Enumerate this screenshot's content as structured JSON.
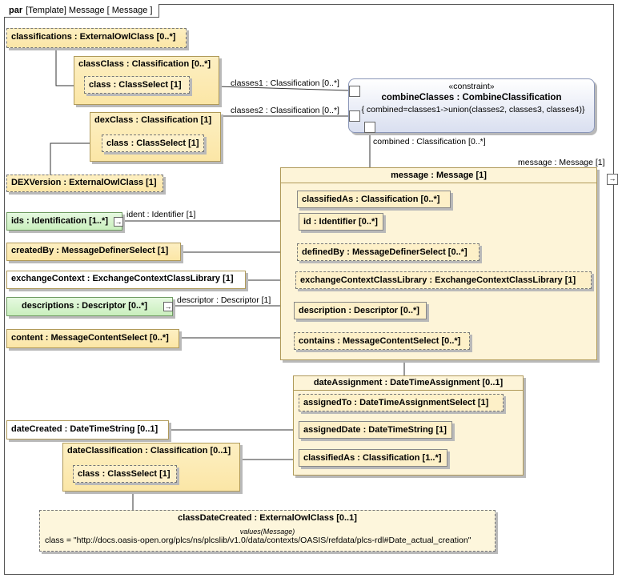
{
  "frame": {
    "keyword": "par",
    "title": "[Template] Message [ Message ]"
  },
  "blocks": {
    "classifications": "classifications : ExternalOwlClass [0..*]",
    "classClass": "classClass : Classification [0..*]",
    "classClass_part": "class : ClassSelect [1]",
    "dexClass": "dexClass : Classification [1]",
    "dexClass_part": "class : ClassSelect [1]",
    "dexVersion": "DEXVersion : ExternalOwlClass [1]",
    "ids": "ids : Identification [1..*]",
    "createdBy": "createdBy : MessageDefinerSelect [1]",
    "exchangeContext": "exchangeContext : ExchangeContextClassLibrary [1]",
    "descriptions": "descriptions : Descriptor [0..*]",
    "content": "content : MessageContentSelect [0..*]",
    "dateCreated": "dateCreated : DateTimeString [0..1]",
    "dateClassification": "dateClassification : Classification [0..1]",
    "dateClassification_part": "class : ClassSelect [1]",
    "classDateCreated": "classDateCreated : ExternalOwlClass [0..1]",
    "classDateCreated_values": "values(Message)",
    "classDateCreated_value": "class = \"http://docs.oasis-open.org/plcs/ns/plcslib/v1.0/data/contexts/OASIS/refdata/plcs-rdl#Date_actual_creation\""
  },
  "constraint": {
    "stereotype": "«constraint»",
    "name": "combineClasses : CombineClassification",
    "expression": "{ combined=classes1->union(classes2, classes3, classes4)}"
  },
  "message": {
    "title": "message : Message [1]",
    "parts": {
      "classifiedAs": "classifiedAs : Classification [0..*]",
      "id": "id : Identifier [0..*]",
      "definedBy": "definedBy : MessageDefinerSelect [0..*]",
      "exchangeContextClassLibrary": "exchangeContextClassLibrary : ExchangeContextClassLibrary [1]",
      "description": "description : Descriptor [0..*]",
      "contains": "contains : MessageContentSelect [0..*]"
    }
  },
  "dateAssignment": {
    "title": "dateAssignment : DateTimeAssignment [0..1]",
    "parts": {
      "assignedTo": "assignedTo : DateTimeAssignmentSelect [1]",
      "assignedDate": "assignedDate : DateTimeString [1]",
      "classifiedAs": "classifiedAs : Classification [1..*]"
    }
  },
  "edges": {
    "classes1": "classes1 : Classification [0..*]",
    "classes2": "classes2 : Classification [0..*]",
    "combined": "combined : Classification [0..*]",
    "messagePort": "message : Message [1]",
    "ident": "ident : Identifier [1]",
    "descriptor": "descriptor : Descriptor [1]"
  }
}
